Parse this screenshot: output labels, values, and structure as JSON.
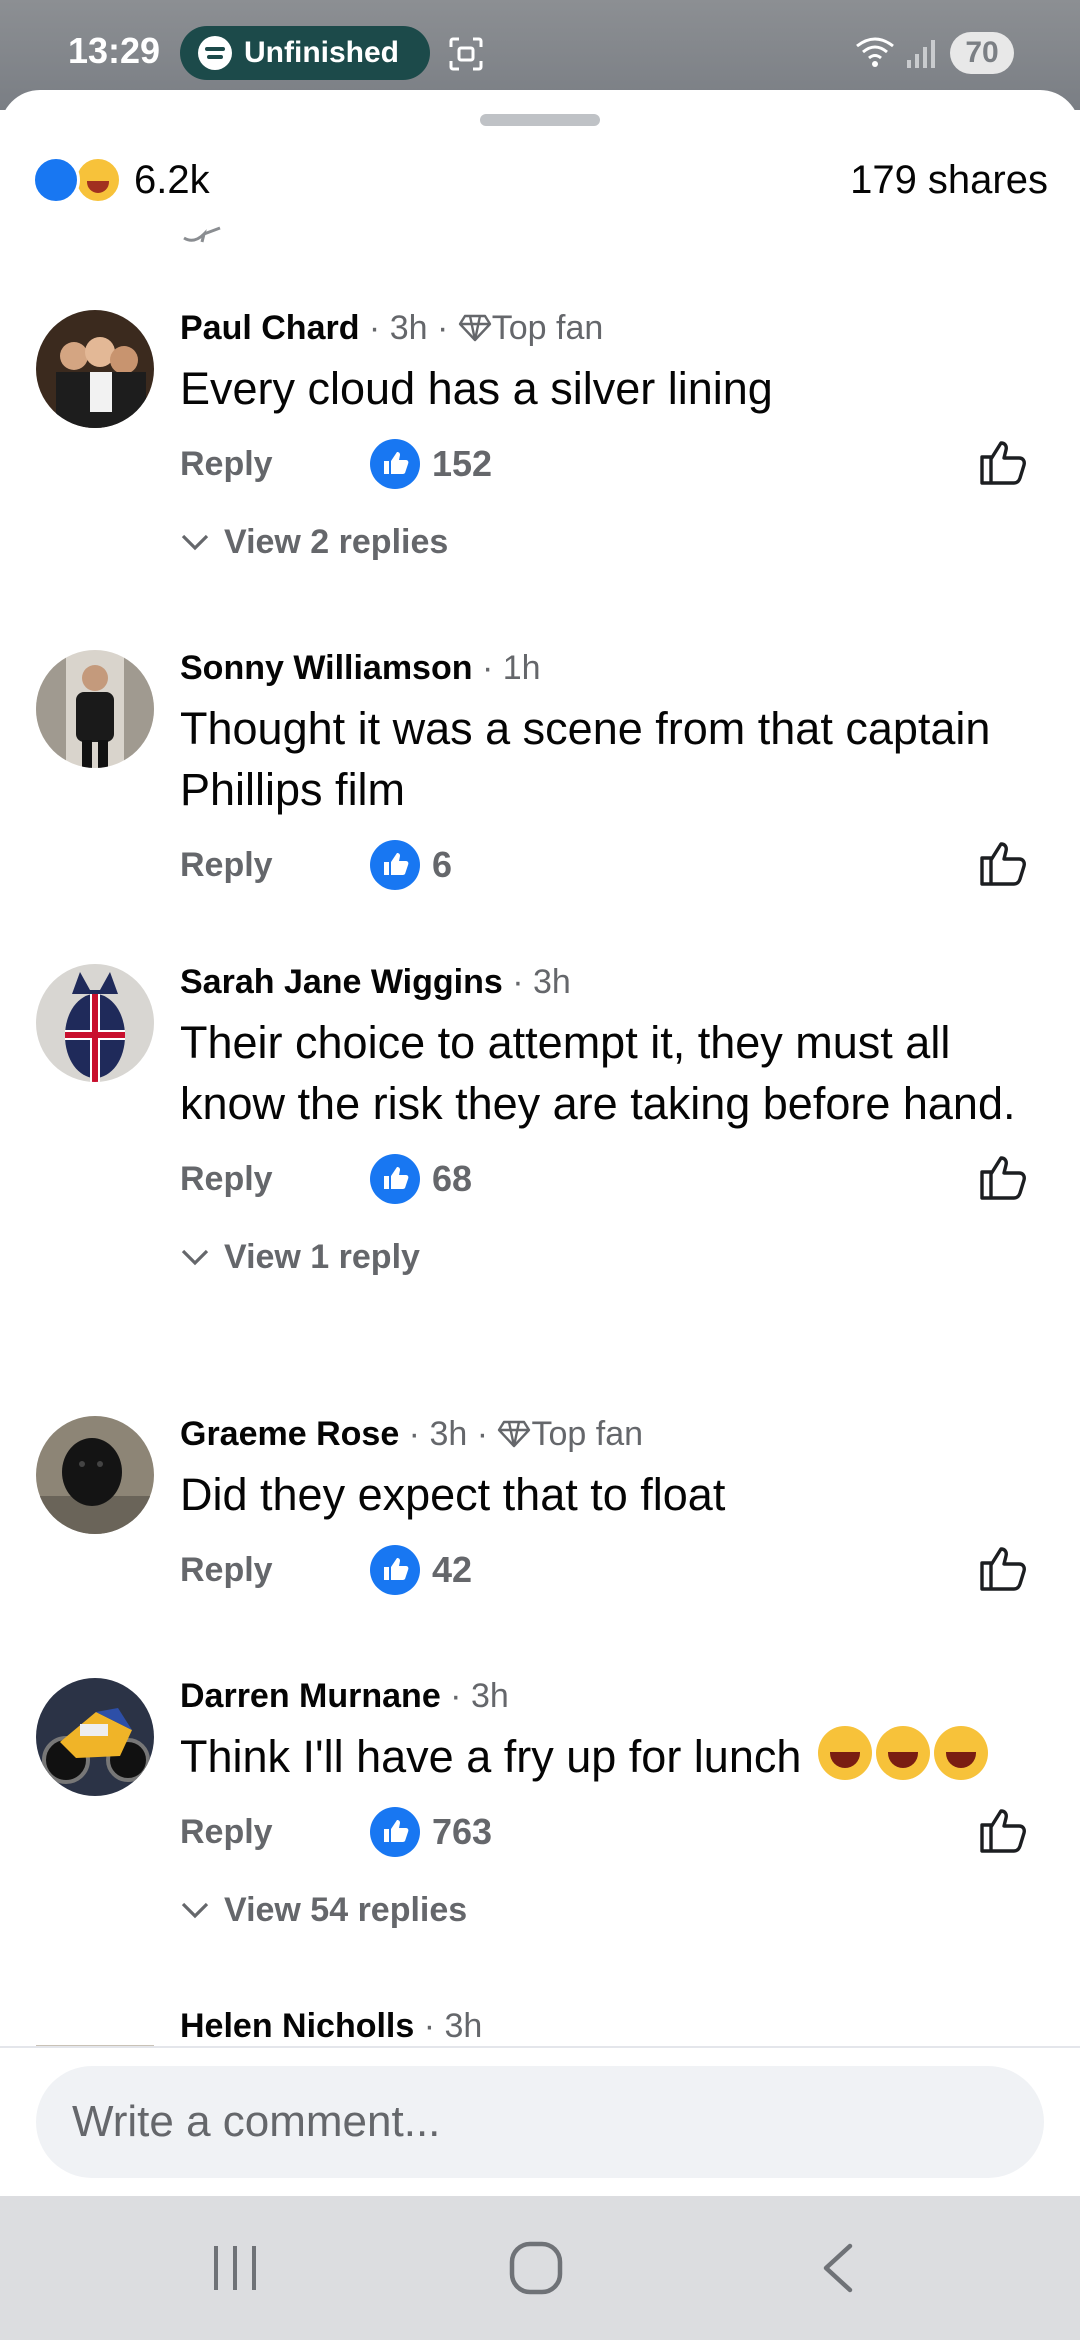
{
  "status_bar": {
    "time": "13:29",
    "media_pill_label": "Unfinished",
    "battery": "70"
  },
  "header": {
    "reaction_count": "6.2k",
    "shares": "179 shares"
  },
  "comments": [
    {
      "name": "Paul Chard",
      "meta": " · 3h · ",
      "badge": "Top fan",
      "text": "Every cloud has a silver lining",
      "reply": "Reply",
      "likes": "152",
      "view_replies": "View 2 replies"
    },
    {
      "name": "Sonny Williamson",
      "meta": " · 1h",
      "text": "Thought it was a scene from that captain Phillips film",
      "reply": "Reply",
      "likes": "6"
    },
    {
      "name": "Sarah Jane Wiggins",
      "meta": " · 3h",
      "text": "Their choice to attempt it, they must all know the risk they are taking before hand.",
      "reply": "Reply",
      "likes": "68",
      "view_replies": "View 1 reply"
    },
    {
      "name": "Graeme Rose",
      "meta": " · 3h · ",
      "badge": "Top fan",
      "text": "Did they expect that to float",
      "reply": "Reply",
      "likes": "42"
    },
    {
      "name": "Darren Murnane",
      "meta": " · 3h",
      "text": "Think I'll have a fry up for lunch",
      "reply": "Reply",
      "likes": "763",
      "view_replies": "View 54 replies"
    },
    {
      "name": "Helen Nicholls",
      "meta": " · 3h"
    }
  ],
  "composer": {
    "placeholder": "Write a comment..."
  },
  "colors": {
    "accent": "#1877f2",
    "secondary_text": "#65676b",
    "spotify_pill": "#1c4a4a"
  }
}
